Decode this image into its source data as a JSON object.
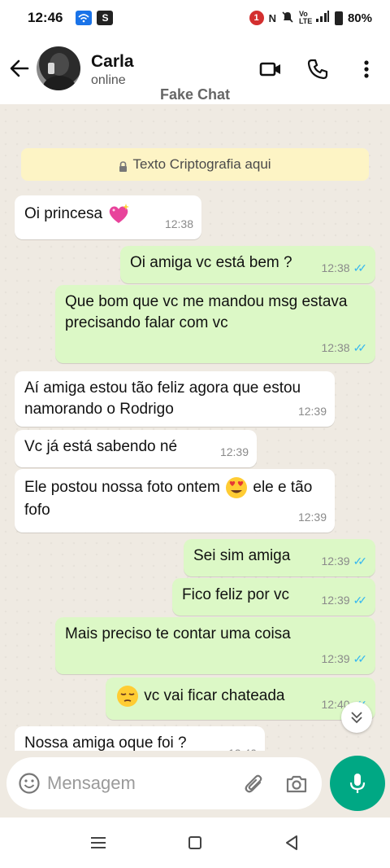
{
  "status_bar": {
    "time": "12:46",
    "app_icon_s": "S",
    "notification_count": "1",
    "network_label": "Vo LTE",
    "battery": "80%"
  },
  "header": {
    "contact_name": "Carla",
    "contact_status": "online",
    "watermark": "Fake Chat"
  },
  "chat": {
    "encryption_notice": "Texto Criptografia aqui",
    "messages": [
      {
        "direction": "in",
        "text": "Oi princesa",
        "time": "12:38",
        "emoji": "heart-sparkle"
      },
      {
        "direction": "out",
        "text": "Oi amiga vc está bem ?",
        "time": "12:38",
        "status": "read"
      },
      {
        "direction": "out",
        "text": "Que bom que vc me mandou msg estava precisando falar com vc",
        "time": "12:38",
        "status": "read"
      },
      {
        "direction": "in",
        "text": "Aí amiga estou tão feliz agora que estou namorando o Rodrigo",
        "time": "12:39"
      },
      {
        "direction": "in",
        "text": "Vc já está sabendo né",
        "time": "12:39"
      },
      {
        "direction": "in",
        "text_before": "Ele postou nossa foto ontem",
        "text_after": "ele e tão fofo",
        "time": "12:39",
        "emoji": "heart-eyes"
      },
      {
        "direction": "out",
        "text": "Sei sim amiga",
        "time": "12:39",
        "status": "read"
      },
      {
        "direction": "out",
        "text": "Fico feliz por vc",
        "time": "12:39",
        "status": "read"
      },
      {
        "direction": "out",
        "text": "Mais preciso te contar uma coisa",
        "time": "12:39",
        "status": "read"
      },
      {
        "direction": "out",
        "text": "vc vai ficar chateada",
        "time": "12:40",
        "emoji": "pensive",
        "status": "read"
      },
      {
        "direction": "in",
        "text": "Nossa amiga oque foi ?",
        "time": "12:40"
      }
    ],
    "ticks": "✓✓"
  },
  "input": {
    "placeholder": "Mensagem"
  },
  "icons": {
    "back": "arrow-left-icon",
    "video": "video-call-icon",
    "call": "phone-icon",
    "menu": "more-vert-icon",
    "lock": "lock-icon",
    "emoji": "emoji-icon",
    "attach": "paperclip-icon",
    "camera": "camera-icon",
    "mic": "microphone-icon",
    "scroll": "chevron-double-down-icon"
  },
  "colors": {
    "accent": "#00a884",
    "outgoing_bubble": "#dcf8c6",
    "incoming_bubble": "#ffffff",
    "chat_background": "#efeae2",
    "read_ticks": "#34b7f1",
    "encryption_banner": "#fdf4c5"
  }
}
